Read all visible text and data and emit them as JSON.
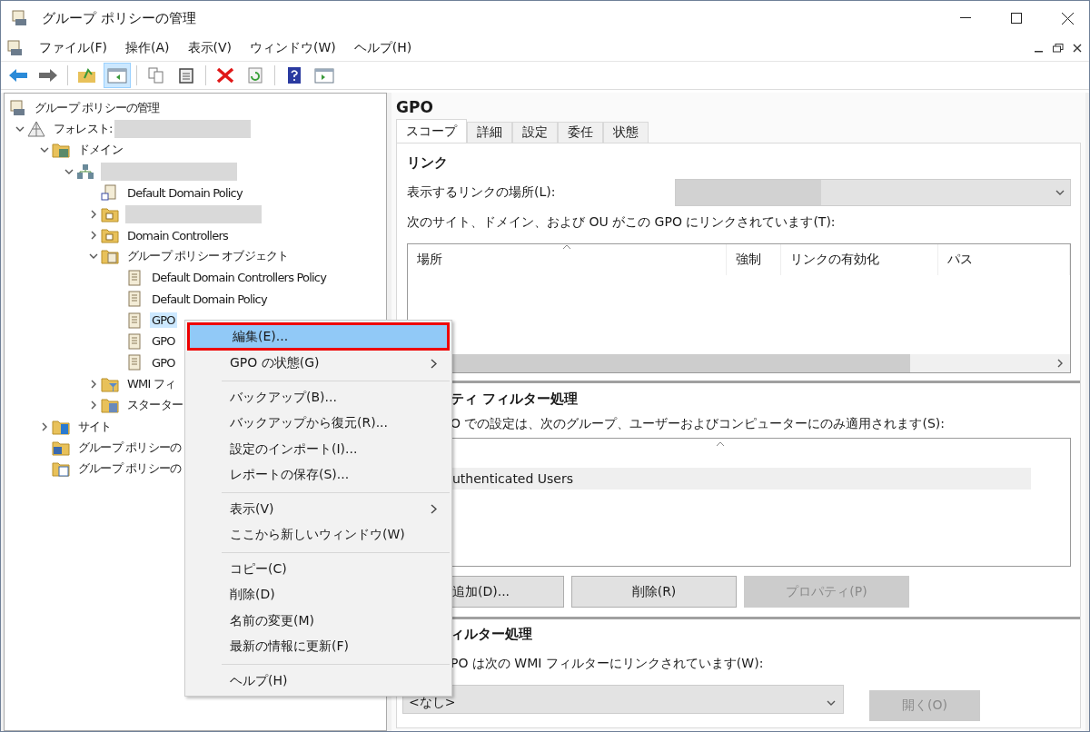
{
  "window": {
    "title": "グループ ポリシーの管理"
  },
  "menu_bar": [
    "ファイル(F)",
    "操作(A)",
    "表示(V)",
    "ウィンドウ(W)",
    "ヘルプ(H)"
  ],
  "toolbar": [
    {
      "pressed": false
    },
    {
      "pressed": false
    },
    {
      "pressed": false
    },
    {
      "pressed": true
    },
    {
      "pressed": false
    },
    {
      "pressed": false
    },
    {
      "pressed": false
    },
    {
      "pressed": false
    },
    {
      "pressed": false
    },
    {
      "pressed": false
    }
  ],
  "tree": [
    {
      "kind": "console",
      "label": "グループ ポリシーの管理",
      "selected": false,
      "children": [
        {
          "kind": "forest",
          "label": "フォレスト:",
          "redacted": true,
          "expanded": true,
          "selected": false,
          "children": [
            {
              "kind": "domains",
              "label": "ドメイン",
              "expanded": true,
              "selected": false,
              "children": [
                {
                  "kind": "domain",
                  "redacted": true,
                  "expanded": true,
                  "selected": false,
                  "children": [
                    {
                      "kind": "gpo-link",
                      "label": "Default Domain Policy",
                      "selected": false
                    },
                    {
                      "kind": "ou",
                      "redacted": true,
                      "expanded": false,
                      "selected": false
                    },
                    {
                      "kind": "ou",
                      "label": "Domain Controllers",
                      "expanded": false,
                      "selected": false
                    },
                    {
                      "kind": "gpo-folder",
                      "label": "グループ ポリシー オブジェクト",
                      "expanded": true,
                      "selected": false,
                      "children": [
                        {
                          "kind": "gpo",
                          "label": "Default Domain Controllers Policy",
                          "selected": false
                        },
                        {
                          "kind": "gpo",
                          "label": "Default Domain Policy",
                          "selected": false
                        },
                        {
                          "kind": "gpo",
                          "label": "GPO",
                          "selected": true
                        },
                        {
                          "kind": "gpo",
                          "label": "GPO",
                          "selected": false
                        },
                        {
                          "kind": "gpo",
                          "label": "GPO",
                          "selected": false
                        }
                      ]
                    },
                    {
                      "kind": "wmi-folder",
                      "label": "WMI フィ",
                      "expanded": false,
                      "selected": false
                    },
                    {
                      "kind": "starter-folder",
                      "label": "スターター",
                      "expanded": false,
                      "selected": false
                    }
                  ]
                }
              ]
            },
            {
              "kind": "sites",
              "label": "サイト",
              "expanded": false,
              "selected": false
            },
            {
              "kind": "modeling",
              "label": "グループ ポリシーの",
              "selected": false
            },
            {
              "kind": "results",
              "label": "グループ ポリシーの",
              "selected": false
            }
          ]
        }
      ]
    }
  ],
  "details": {
    "title": "GPO",
    "tabs": [
      {
        "label": "スコープ",
        "selected": true
      },
      {
        "label": "詳細",
        "selected": false
      },
      {
        "label": "設定",
        "selected": false
      },
      {
        "label": "委任",
        "selected": false
      },
      {
        "label": "状態",
        "selected": false
      }
    ],
    "links": {
      "heading": "リンク",
      "location_label": "表示するリンクの場所(L):",
      "location_redacted": true,
      "linked_label": "次のサイト、ドメイン、および OU がこの GPO にリンクされています(T):",
      "columns": [
        "場所",
        "強制",
        "リンクの有効化",
        "パス"
      ]
    },
    "security": {
      "heading": "ティ フィルター処理",
      "description": "O での設定は、次のグループ、ユーザーおよびコンピューターにのみ適用されます(S):",
      "rows": [
        {
          "name": "uthenticated Users",
          "selected": true
        }
      ],
      "buttons": [
        {
          "label": "追加(D)...",
          "disabled": false
        },
        {
          "label": "削除(R)",
          "disabled": false
        },
        {
          "label": "プロパティ(P)",
          "disabled": true
        }
      ]
    },
    "wmi": {
      "heading": "ィルター処理",
      "description": "PO は次の WMI フィルターにリンクされています(W):",
      "value": "<なし>",
      "button": {
        "label": "開く(O)",
        "disabled": true
      }
    }
  },
  "context_menu": {
    "items": [
      {
        "kind": "item",
        "label": "編集(E)...",
        "submenu": false,
        "selected": true
      },
      {
        "kind": "item",
        "label": "GPO の状態(G)",
        "submenu": true,
        "selected": false
      },
      {
        "kind": "separator"
      },
      {
        "kind": "item",
        "label": "バックアップ(B)...",
        "submenu": false,
        "selected": false
      },
      {
        "kind": "item",
        "label": "バックアップから復元(R)...",
        "submenu": false,
        "selected": false
      },
      {
        "kind": "item",
        "label": "設定のインポート(I)...",
        "submenu": false,
        "selected": false
      },
      {
        "kind": "item",
        "label": "レポートの保存(S)...",
        "selected": false
      },
      {
        "kind": "separator"
      },
      {
        "kind": "item",
        "label": "表示(V)",
        "submenu": true,
        "selected": false
      },
      {
        "kind": "item",
        "label": "ここから新しいウィンドウ(W)",
        "submenu": false,
        "selected": false
      },
      {
        "kind": "separator"
      },
      {
        "kind": "item",
        "label": "コピー(C)",
        "submenu": false,
        "selected": false
      },
      {
        "kind": "item",
        "label": "削除(D)",
        "submenu": false,
        "selected": false
      },
      {
        "kind": "item",
        "label": "名前の変更(M)",
        "submenu": false,
        "selected": false
      },
      {
        "kind": "item",
        "label": "最新の情報に更新(F)",
        "submenu": false,
        "selected": false
      },
      {
        "kind": "separator"
      },
      {
        "kind": "item",
        "label": "ヘルプ(H)",
        "submenu": false,
        "selected": false
      }
    ]
  }
}
